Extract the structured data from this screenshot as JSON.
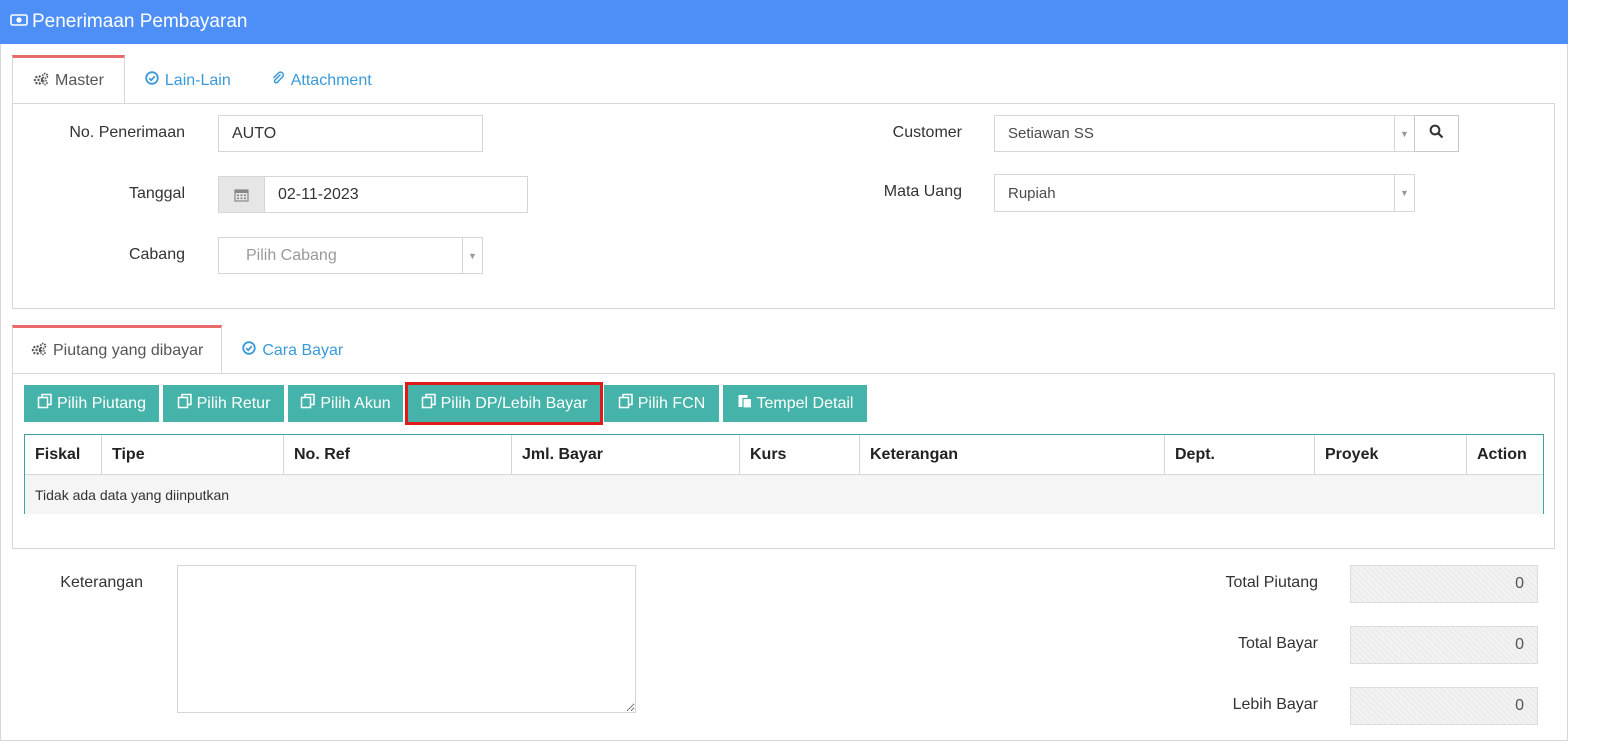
{
  "window": {
    "title": "Penerimaan Pembayaran",
    "icon": "money-icon",
    "title_bar_color": "#4d8ff6"
  },
  "top_tabs": [
    {
      "label": "Master",
      "icon": "cogs-icon",
      "active": true
    },
    {
      "label": "Lain-Lain",
      "icon": "check-circle-icon",
      "active": false
    },
    {
      "label": "Attachment",
      "icon": "paperclip-icon",
      "active": false
    }
  ],
  "master": {
    "no_penerimaan": {
      "label": "No. Penerimaan",
      "value": "AUTO"
    },
    "tanggal": {
      "label": "Tanggal",
      "value": "02-11-2023",
      "icon": "calendar-icon"
    },
    "cabang": {
      "label": "Cabang",
      "placeholder": "Pilih Cabang"
    },
    "customer": {
      "label": "Customer",
      "value": "Setiawan SS",
      "search_icon": "search-icon"
    },
    "mata_uang": {
      "label": "Mata Uang",
      "value": "Rupiah"
    }
  },
  "detail_tabs": [
    {
      "label": "Piutang yang dibayar",
      "icon": "cogs-icon",
      "active": true
    },
    {
      "label": "Cara Bayar",
      "icon": "check-circle-icon",
      "active": false
    }
  ],
  "actions": {
    "pilih_piutang": "Pilih Piutang",
    "pilih_retur": "Pilih Retur",
    "pilih_akun": "Pilih Akun",
    "pilih_dp": "Pilih DP/Lebih Bayar",
    "pilih_fcn": "Pilih FCN",
    "tempel_detail": "Tempel Detail",
    "button_color": "#45b3a9",
    "highlight_color": "#e01919"
  },
  "table": {
    "columns": [
      "Fiskal",
      "Tipe",
      "No. Ref",
      "Jml. Bayar",
      "Kurs",
      "Keterangan",
      "Dept.",
      "Proyek",
      "Action"
    ],
    "empty_message": "Tidak ada data yang diinputkan"
  },
  "footer": {
    "keterangan_label": "Keterangan",
    "keterangan_value": "",
    "total_piutang": {
      "label": "Total Piutang",
      "value": "0"
    },
    "total_bayar": {
      "label": "Total Bayar",
      "value": "0"
    },
    "lebih_bayar": {
      "label": "Lebih Bayar",
      "value": "0"
    }
  }
}
